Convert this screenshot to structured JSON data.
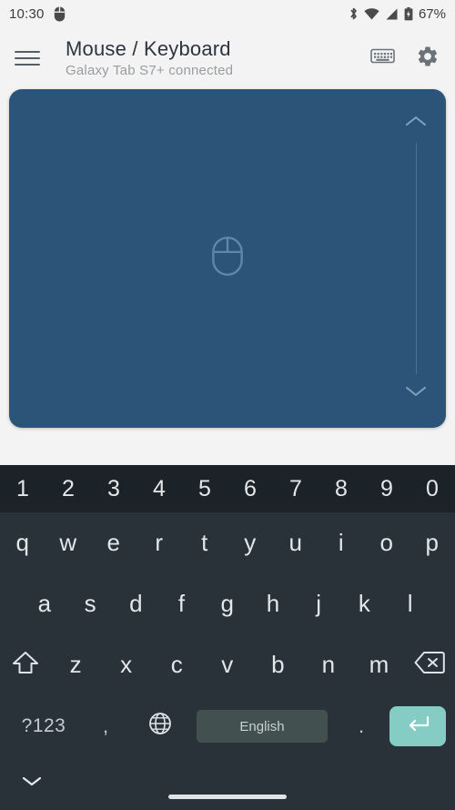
{
  "status_bar": {
    "time": "10:30",
    "left_icons": [
      "mouse-icon"
    ],
    "right_icons": [
      "bluetooth-icon",
      "wifi-icon",
      "cellular-signal-icon",
      "battery-icon"
    ],
    "battery_percent": "67%"
  },
  "header": {
    "menu_icon": "hamburger-menu-icon",
    "title": "Mouse / Keyboard",
    "subtitle": "Galaxy Tab S7+ connected",
    "actions": [
      {
        "icon": "keyboard-icon",
        "name": "toggle-keyboard-button"
      },
      {
        "icon": "gear-icon",
        "name": "settings-button"
      }
    ]
  },
  "touchpad": {
    "background_color": "#2c5479",
    "center_icon": "mouse-icon",
    "scroll_strip": {
      "up_icon": "chevron-up-icon",
      "down_icon": "chevron-down-icon"
    }
  },
  "keyboard": {
    "background_color": "#283238",
    "number_row_color": "#1c2328",
    "accent_color": "#85ccc4",
    "rows": {
      "numbers": [
        "1",
        "2",
        "3",
        "4",
        "5",
        "6",
        "7",
        "8",
        "9",
        "0"
      ],
      "row1": [
        "q",
        "w",
        "e",
        "r",
        "t",
        "y",
        "u",
        "i",
        "o",
        "p"
      ],
      "row2": [
        "a",
        "s",
        "d",
        "f",
        "g",
        "h",
        "j",
        "k",
        "l"
      ],
      "row3_letters": [
        "z",
        "x",
        "c",
        "v",
        "b",
        "n",
        "m"
      ],
      "shift_icon": "shift-icon",
      "backspace_icon": "backspace-icon"
    },
    "bottom_row": {
      "symbols_label": "?123",
      "comma": ",",
      "globe_icon": "globe-icon",
      "spacebar_label": "English",
      "period": ".",
      "enter_icon": "enter-icon"
    }
  },
  "navigation_bar": {
    "hide_keyboard_icon": "chevron-down-icon",
    "home_indicator": "home-indicator-pill"
  }
}
